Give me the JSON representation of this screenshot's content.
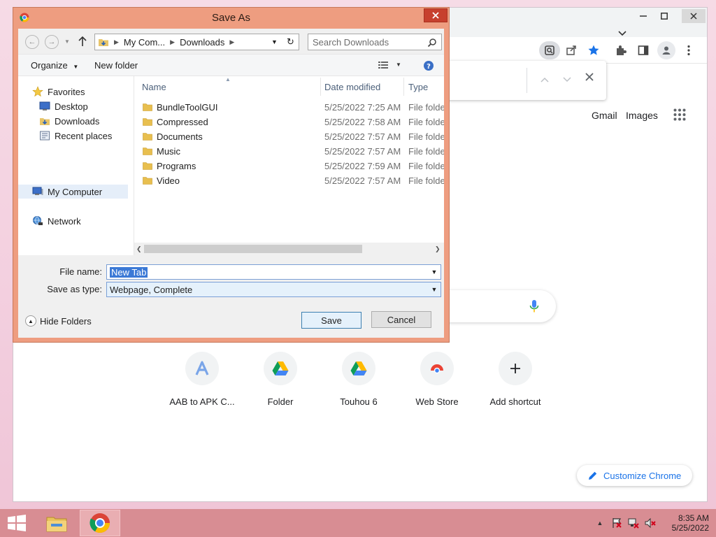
{
  "colors": {
    "dialog_frame": "#ee9d80",
    "taskbar": "#d88d93",
    "chrome_blue": "#1a73e8",
    "selection": "#3b79d6"
  },
  "dialog": {
    "title": "Save As",
    "address": {
      "segments": [
        "My Com...",
        "Downloads"
      ],
      "folder_icon": "downloads-folder-icon"
    },
    "search_placeholder": "Search Downloads",
    "commands": {
      "organize": "Organize",
      "new_folder": "New folder"
    },
    "nav": {
      "favorites": "Favorites",
      "desktop": "Desktop",
      "downloads": "Downloads",
      "recent_places": "Recent places",
      "my_computer": "My Computer",
      "network": "Network"
    },
    "columns": {
      "name": "Name",
      "date_modified": "Date modified",
      "type": "Type"
    },
    "files": [
      {
        "name": "BundleToolGUI",
        "date": "5/25/2022 7:25 AM",
        "type": "File folder"
      },
      {
        "name": "Compressed",
        "date": "5/25/2022 7:58 AM",
        "type": "File folder"
      },
      {
        "name": "Documents",
        "date": "5/25/2022 7:57 AM",
        "type": "File folder"
      },
      {
        "name": "Music",
        "date": "5/25/2022 7:57 AM",
        "type": "File folder"
      },
      {
        "name": "Programs",
        "date": "5/25/2022 7:59 AM",
        "type": "File folder"
      },
      {
        "name": "Video",
        "date": "5/25/2022 7:57 AM",
        "type": "File folder"
      }
    ],
    "file_name_label": "File name:",
    "file_name_value": "New Tab",
    "save_type_label": "Save as type:",
    "save_type_value": "Webpage, Complete",
    "hide_folders": "Hide Folders",
    "save_button": "Save",
    "cancel_button": "Cancel"
  },
  "chrome": {
    "gmail": "Gmail",
    "images": "Images",
    "shortcuts": [
      {
        "label": "AAB to APK C...",
        "icon": "letter-a-icon"
      },
      {
        "label": "Folder",
        "icon": "google-drive-icon"
      },
      {
        "label": "Touhou 6",
        "icon": "google-drive-icon"
      },
      {
        "label": "Web Store",
        "icon": "chrome-web-store-icon"
      },
      {
        "label": "Add shortcut",
        "icon": "plus-icon"
      }
    ],
    "customize": "Customize Chrome"
  },
  "taskbar": {
    "time": "8:35 AM",
    "date": "5/25/2022"
  }
}
